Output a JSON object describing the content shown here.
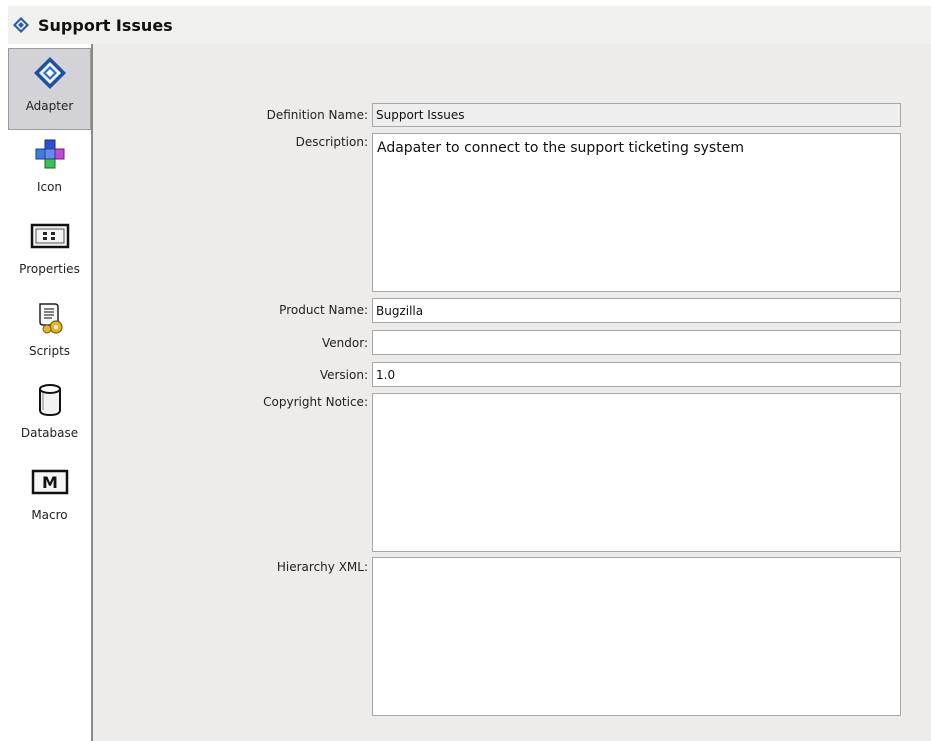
{
  "window": {
    "title": "Support Issues",
    "title_icon": "adapter-diamond-icon"
  },
  "sidebar": {
    "items": [
      {
        "label": "Adapter",
        "icon": "adapter-diamond-icon",
        "selected": true
      },
      {
        "label": "Icon",
        "icon": "puzzle-squares-icon",
        "selected": false
      },
      {
        "label": "Properties",
        "icon": "properties-grid-icon",
        "selected": false
      },
      {
        "label": "Scripts",
        "icon": "script-scroll-icon",
        "selected": false
      },
      {
        "label": "Database",
        "icon": "database-cylinder-icon",
        "selected": false
      },
      {
        "label": "Macro",
        "icon": "macro-m-icon",
        "selected": false
      }
    ]
  },
  "form": {
    "definition_name": {
      "label": "Definition Name:",
      "value": "Support Issues"
    },
    "description": {
      "label": "Description:",
      "value": "Adapater to connect to the support ticketing system"
    },
    "product_name": {
      "label": "Product Name:",
      "value": "Bugzilla"
    },
    "vendor": {
      "label": "Vendor:",
      "value": ""
    },
    "version": {
      "label": "Version:",
      "value": "1.0"
    },
    "copyright_notice": {
      "label": "Copyright Notice:",
      "value": ""
    },
    "hierarchy_xml": {
      "label": "Hierarchy XML:",
      "value": ""
    }
  }
}
